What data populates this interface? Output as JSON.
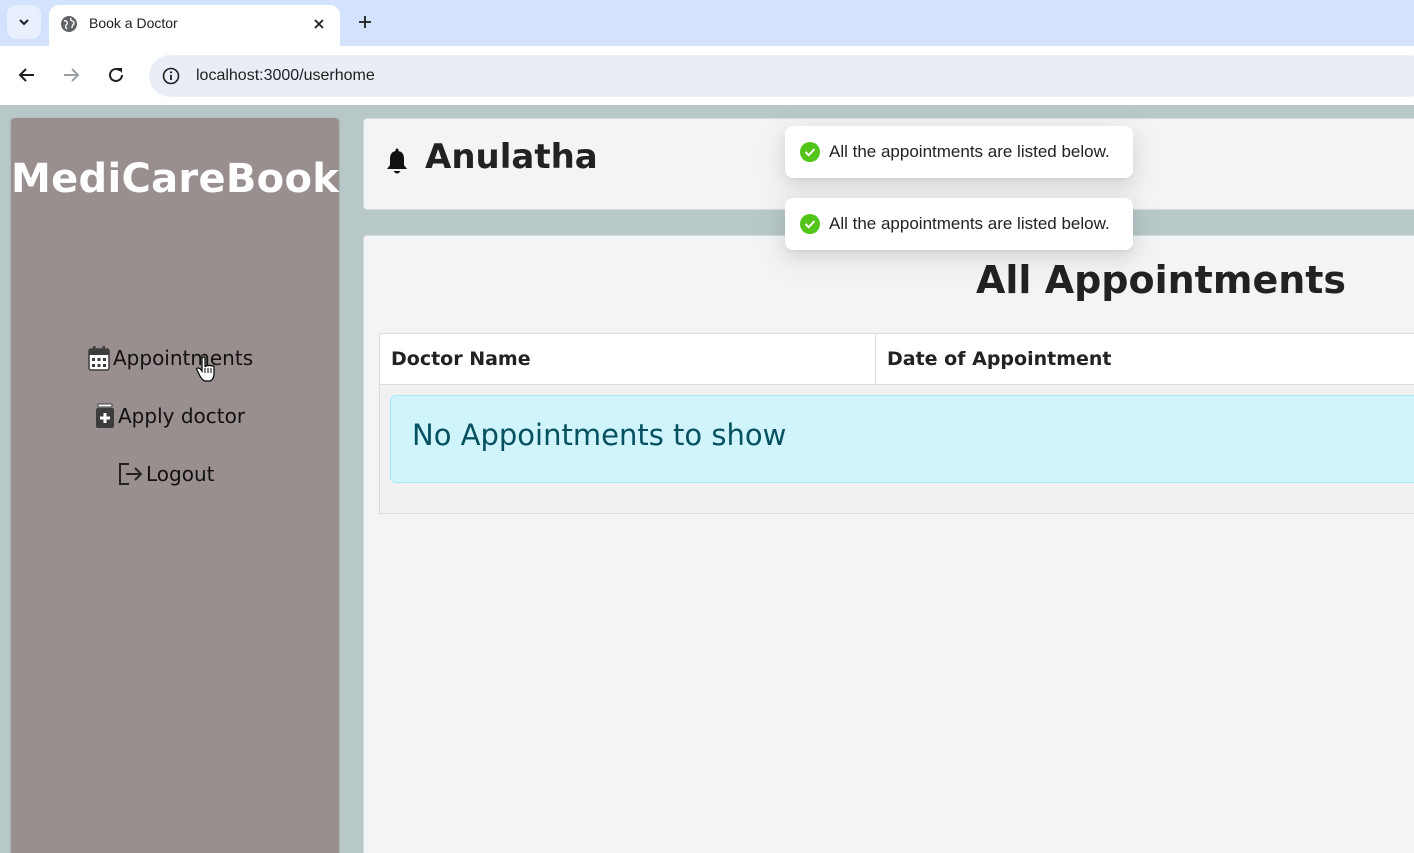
{
  "browser": {
    "tab_title": "Book a Doctor",
    "url": "localhost:3000/userhome"
  },
  "sidebar": {
    "brand": "MediCareBook",
    "items": [
      {
        "label": "Appointments",
        "icon": "calendar-icon"
      },
      {
        "label": "Apply doctor",
        "icon": "medical-file-icon"
      },
      {
        "label": "Logout",
        "icon": "logout-icon"
      }
    ]
  },
  "header": {
    "user_name": "Anulatha",
    "icon": "bell-icon"
  },
  "main": {
    "title": "All Appointments",
    "columns": [
      "Doctor Name",
      "Date of Appointment"
    ],
    "empty_message": "No Appointments to show"
  },
  "toasts": [
    {
      "message": "All the appointments are listed below.",
      "type": "success"
    },
    {
      "message": "All the appointments are listed below.",
      "type": "success"
    }
  ],
  "colors": {
    "sidebar_bg": "#9a8f8f",
    "page_bg": "#b8c8c8",
    "alert_bg": "#cff4fc",
    "alert_text": "#055160",
    "success": "#52c41a"
  }
}
